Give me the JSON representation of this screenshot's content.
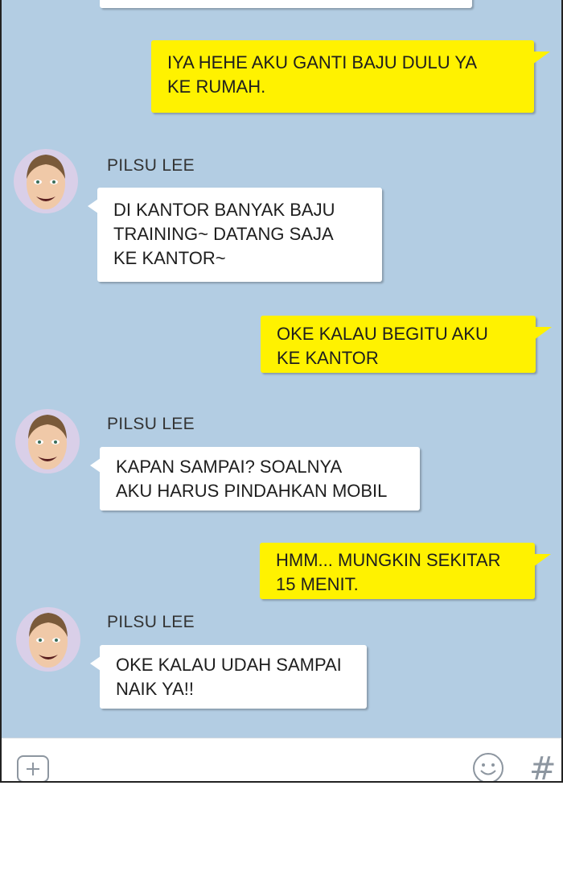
{
  "messages": [
    {
      "type": "out",
      "lines": [
        "IYA HEHE AKU GANTI BAJU DULU YA",
        "KE RUMAH."
      ]
    },
    {
      "type": "in",
      "sender": "PILSU LEE",
      "lines": [
        "DI KANTOR BANYAK BAJU",
        "TRAINING~ DATANG SAJA",
        "KE KANTOR~"
      ]
    },
    {
      "type": "out",
      "lines": [
        "OKE KALAU BEGITU AKU",
        "KE KANTOR"
      ]
    },
    {
      "type": "in",
      "sender": "PILSU LEE",
      "lines": [
        "KAPAN SAMPAI? SOALNYA",
        "AKU HARUS PINDAHKAN MOBIL"
      ]
    },
    {
      "type": "out",
      "lines": [
        "HMM... MUNGKIN SEKITAR",
        "15 MENIT."
      ]
    },
    {
      "type": "in",
      "sender": "PILSU LEE",
      "lines": [
        "OKE KALAU UDAH SAMPAI",
        "NAIK YA!!"
      ]
    }
  ],
  "input_bar": {
    "left_icon": "plus-square-icon",
    "emoji_icon": "smiley-icon",
    "hash_icon": "hashtag-icon",
    "hash_glyph": "#"
  },
  "colors": {
    "background": "#b3cde3",
    "outgoing": "#fff200",
    "incoming": "#ffffff"
  }
}
